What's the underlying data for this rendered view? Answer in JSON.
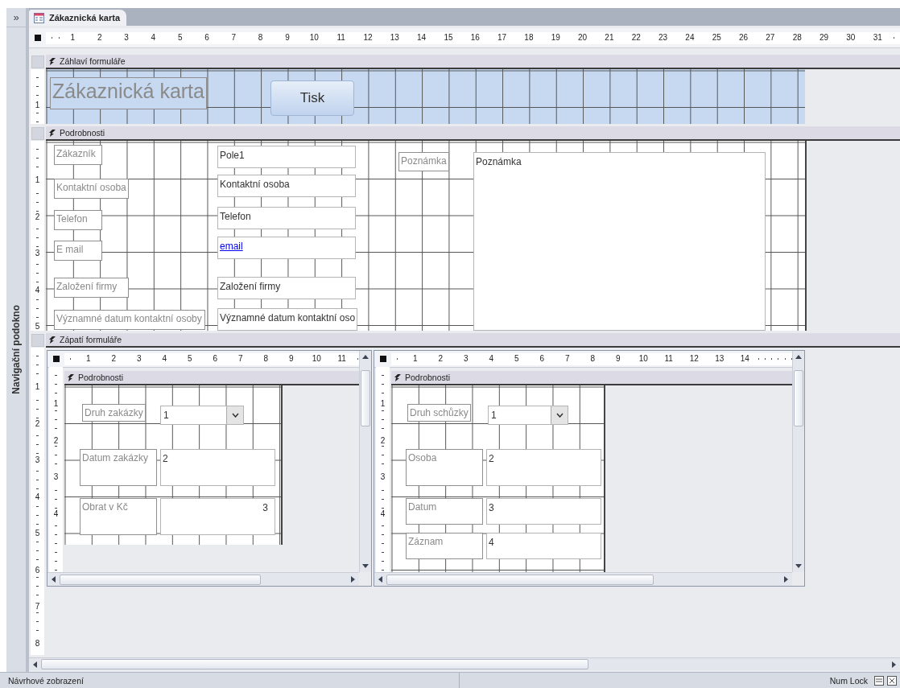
{
  "nav_pane": {
    "toggle": "»",
    "title": "Navigační podokno"
  },
  "tabs": [
    {
      "label": "Zákaznická karta",
      "selected": true
    }
  ],
  "ruler": [
    "1",
    "2",
    "3",
    "4",
    "5",
    "6",
    "7",
    "8",
    "9",
    "10",
    "11",
    "12",
    "13",
    "14",
    "15",
    "16",
    "17",
    "18",
    "19",
    "20",
    "21",
    "22",
    "23",
    "24",
    "25",
    "26",
    "27",
    "28",
    "29",
    "30",
    "31"
  ],
  "sections": [
    {
      "kind": "header",
      "title": "Záhlaví formuláře",
      "ruler": [
        "1"
      ],
      "controls": [
        {
          "kind": "title",
          "text": "Zákaznická karta"
        },
        {
          "kind": "button",
          "text": "Tisk"
        }
      ]
    },
    {
      "kind": "detail",
      "title": "Podrobnosti",
      "ruler": [
        "1",
        "2",
        "3",
        "4",
        "5"
      ],
      "controls": [
        {
          "kind": "label",
          "text": "Zákazník"
        },
        {
          "kind": "label",
          "text": "Kontaktní osoba"
        },
        {
          "kind": "label",
          "text": "Telefon"
        },
        {
          "kind": "label",
          "text": "E mail"
        },
        {
          "kind": "label",
          "text": "Založení firmy"
        },
        {
          "kind": "label",
          "text": "Významné datum kontaktní osoby"
        },
        {
          "kind": "textbox",
          "text": "Pole1"
        },
        {
          "kind": "textbox",
          "text": "Kontaktní osoba"
        },
        {
          "kind": "textbox",
          "text": "Telefon"
        },
        {
          "kind": "hyperlink",
          "text": "email"
        },
        {
          "kind": "textbox",
          "text": "Založení firmy"
        },
        {
          "kind": "textbox",
          "text": "Významné datum kontaktní oso"
        },
        {
          "kind": "label",
          "text": "Poznámka"
        },
        {
          "kind": "textbox",
          "text": "Poznámka"
        }
      ]
    },
    {
      "kind": "footer",
      "title": "Zápatí formuláře",
      "ruler": [
        "1",
        "2",
        "3",
        "4",
        "5",
        "6",
        "7",
        "8"
      ],
      "subforms": [
        {
          "ruler": [
            "1",
            "2",
            "3",
            "4",
            "5",
            "6",
            "7",
            "8",
            "9",
            "10",
            "11"
          ],
          "section_title": "Podrobnosti",
          "vruler": [
            "1",
            "2",
            "3",
            "4"
          ],
          "controls": [
            {
              "kind": "label",
              "text": "Druh zakázky"
            },
            {
              "kind": "combo",
              "text": "1"
            },
            {
              "kind": "label",
              "text": "Datum zakázky"
            },
            {
              "kind": "textbox",
              "text": "2"
            },
            {
              "kind": "label",
              "text": "Obrat v Kč"
            },
            {
              "kind": "number",
              "text": "3"
            }
          ]
        },
        {
          "ruler": [
            "1",
            "2",
            "3",
            "4",
            "5",
            "6",
            "7",
            "8",
            "9",
            "10",
            "11",
            "12",
            "13",
            "14"
          ],
          "section_title": "Podrobnosti",
          "vruler": [
            "1",
            "2",
            "3",
            "4"
          ],
          "controls": [
            {
              "kind": "label",
              "text": "Druh schůzky"
            },
            {
              "kind": "combo",
              "text": "1"
            },
            {
              "kind": "label",
              "text": "Osoba"
            },
            {
              "kind": "textbox",
              "text": "2"
            },
            {
              "kind": "label",
              "text": "Datum"
            },
            {
              "kind": "textbox",
              "text": "3"
            },
            {
              "kind": "label",
              "text": "Záznam"
            },
            {
              "kind": "textbox",
              "text": "4"
            }
          ]
        }
      ]
    }
  ],
  "status_bar": {
    "mode": "Návrhové zobrazení",
    "num_lock": "Num Lock"
  }
}
